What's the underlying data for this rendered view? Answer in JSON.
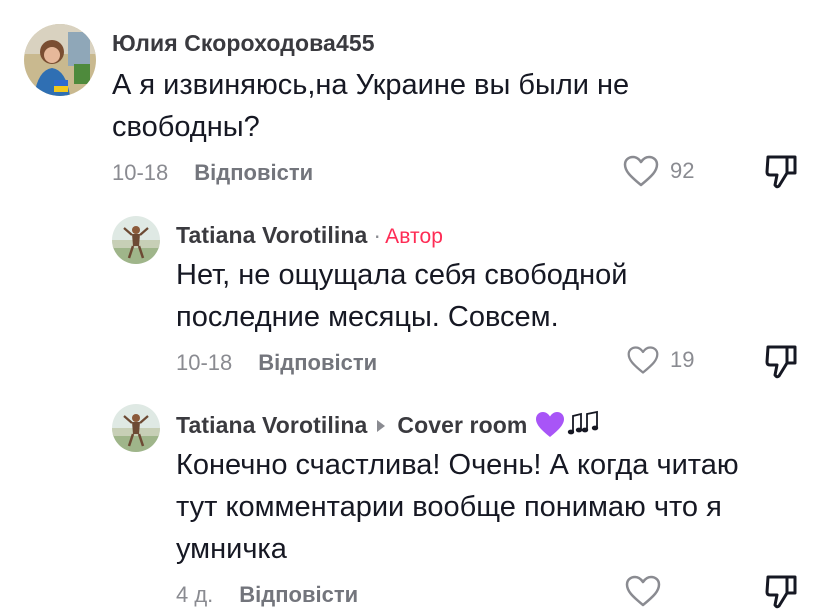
{
  "comments": [
    {
      "username": "Юлия Скороходова455",
      "text_lines": [
        "А я извиняюсь,на Украине вы были не",
        "свободны?"
      ],
      "date": "10-18",
      "reply_label": "Відповісти",
      "likes": "92"
    },
    {
      "username": "Tatiana Vorotilina",
      "separator": "·",
      "author_tag": "Автор",
      "text_lines": [
        "Нет, не ощущала себя свободной",
        "последние месяцы. Совсем."
      ],
      "date": "10-18",
      "reply_label": "Відповісти",
      "likes": "19"
    },
    {
      "username": "Tatiana Vorotilina",
      "reply_to": "Cover room",
      "reply_to_emojis": [
        "purple-heart-emoji",
        "music-notes-emoji"
      ],
      "text_lines": [
        "Конечно счастлива! Очень! А когда читаю",
        "тут комментарии вообще понимаю что я",
        "умничка"
      ],
      "date": "4 д.",
      "reply_label": "Відповісти",
      "likes": ""
    }
  ],
  "colors": {
    "text": "#161823",
    "muted": "#8a8b91",
    "author_tag": "#fe2c55",
    "heart_emoji": "#a855f7"
  },
  "icons": [
    "heart-outline-icon",
    "dislike-icon"
  ]
}
